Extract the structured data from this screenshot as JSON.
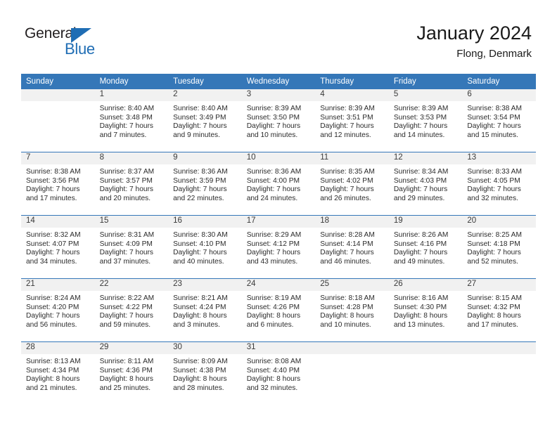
{
  "brand": {
    "name_dark": "General",
    "name_blue": "Blue",
    "accent_color": "#1f6db4"
  },
  "header": {
    "title": "January 2024",
    "subtitle": "Flong, Denmark"
  },
  "calendar": {
    "header_color": "#3577b8",
    "weekday_headers": [
      "Sunday",
      "Monday",
      "Tuesday",
      "Wednesday",
      "Thursday",
      "Friday",
      "Saturday"
    ],
    "weeks": [
      [
        {
          "day": "",
          "sunrise": "",
          "sunset": "",
          "daylight_line1": "",
          "daylight_line2": ""
        },
        {
          "day": "1",
          "sunrise": "Sunrise: 8:40 AM",
          "sunset": "Sunset: 3:48 PM",
          "daylight_line1": "Daylight: 7 hours",
          "daylight_line2": "and 7 minutes."
        },
        {
          "day": "2",
          "sunrise": "Sunrise: 8:40 AM",
          "sunset": "Sunset: 3:49 PM",
          "daylight_line1": "Daylight: 7 hours",
          "daylight_line2": "and 9 minutes."
        },
        {
          "day": "3",
          "sunrise": "Sunrise: 8:39 AM",
          "sunset": "Sunset: 3:50 PM",
          "daylight_line1": "Daylight: 7 hours",
          "daylight_line2": "and 10 minutes."
        },
        {
          "day": "4",
          "sunrise": "Sunrise: 8:39 AM",
          "sunset": "Sunset: 3:51 PM",
          "daylight_line1": "Daylight: 7 hours",
          "daylight_line2": "and 12 minutes."
        },
        {
          "day": "5",
          "sunrise": "Sunrise: 8:39 AM",
          "sunset": "Sunset: 3:53 PM",
          "daylight_line1": "Daylight: 7 hours",
          "daylight_line2": "and 14 minutes."
        },
        {
          "day": "6",
          "sunrise": "Sunrise: 8:38 AM",
          "sunset": "Sunset: 3:54 PM",
          "daylight_line1": "Daylight: 7 hours",
          "daylight_line2": "and 15 minutes."
        }
      ],
      [
        {
          "day": "7",
          "sunrise": "Sunrise: 8:38 AM",
          "sunset": "Sunset: 3:56 PM",
          "daylight_line1": "Daylight: 7 hours",
          "daylight_line2": "and 17 minutes."
        },
        {
          "day": "8",
          "sunrise": "Sunrise: 8:37 AM",
          "sunset": "Sunset: 3:57 PM",
          "daylight_line1": "Daylight: 7 hours",
          "daylight_line2": "and 20 minutes."
        },
        {
          "day": "9",
          "sunrise": "Sunrise: 8:36 AM",
          "sunset": "Sunset: 3:59 PM",
          "daylight_line1": "Daylight: 7 hours",
          "daylight_line2": "and 22 minutes."
        },
        {
          "day": "10",
          "sunrise": "Sunrise: 8:36 AM",
          "sunset": "Sunset: 4:00 PM",
          "daylight_line1": "Daylight: 7 hours",
          "daylight_line2": "and 24 minutes."
        },
        {
          "day": "11",
          "sunrise": "Sunrise: 8:35 AM",
          "sunset": "Sunset: 4:02 PM",
          "daylight_line1": "Daylight: 7 hours",
          "daylight_line2": "and 26 minutes."
        },
        {
          "day": "12",
          "sunrise": "Sunrise: 8:34 AM",
          "sunset": "Sunset: 4:03 PM",
          "daylight_line1": "Daylight: 7 hours",
          "daylight_line2": "and 29 minutes."
        },
        {
          "day": "13",
          "sunrise": "Sunrise: 8:33 AM",
          "sunset": "Sunset: 4:05 PM",
          "daylight_line1": "Daylight: 7 hours",
          "daylight_line2": "and 32 minutes."
        }
      ],
      [
        {
          "day": "14",
          "sunrise": "Sunrise: 8:32 AM",
          "sunset": "Sunset: 4:07 PM",
          "daylight_line1": "Daylight: 7 hours",
          "daylight_line2": "and 34 minutes."
        },
        {
          "day": "15",
          "sunrise": "Sunrise: 8:31 AM",
          "sunset": "Sunset: 4:09 PM",
          "daylight_line1": "Daylight: 7 hours",
          "daylight_line2": "and 37 minutes."
        },
        {
          "day": "16",
          "sunrise": "Sunrise: 8:30 AM",
          "sunset": "Sunset: 4:10 PM",
          "daylight_line1": "Daylight: 7 hours",
          "daylight_line2": "and 40 minutes."
        },
        {
          "day": "17",
          "sunrise": "Sunrise: 8:29 AM",
          "sunset": "Sunset: 4:12 PM",
          "daylight_line1": "Daylight: 7 hours",
          "daylight_line2": "and 43 minutes."
        },
        {
          "day": "18",
          "sunrise": "Sunrise: 8:28 AM",
          "sunset": "Sunset: 4:14 PM",
          "daylight_line1": "Daylight: 7 hours",
          "daylight_line2": "and 46 minutes."
        },
        {
          "day": "19",
          "sunrise": "Sunrise: 8:26 AM",
          "sunset": "Sunset: 4:16 PM",
          "daylight_line1": "Daylight: 7 hours",
          "daylight_line2": "and 49 minutes."
        },
        {
          "day": "20",
          "sunrise": "Sunrise: 8:25 AM",
          "sunset": "Sunset: 4:18 PM",
          "daylight_line1": "Daylight: 7 hours",
          "daylight_line2": "and 52 minutes."
        }
      ],
      [
        {
          "day": "21",
          "sunrise": "Sunrise: 8:24 AM",
          "sunset": "Sunset: 4:20 PM",
          "daylight_line1": "Daylight: 7 hours",
          "daylight_line2": "and 56 minutes."
        },
        {
          "day": "22",
          "sunrise": "Sunrise: 8:22 AM",
          "sunset": "Sunset: 4:22 PM",
          "daylight_line1": "Daylight: 7 hours",
          "daylight_line2": "and 59 minutes."
        },
        {
          "day": "23",
          "sunrise": "Sunrise: 8:21 AM",
          "sunset": "Sunset: 4:24 PM",
          "daylight_line1": "Daylight: 8 hours",
          "daylight_line2": "and 3 minutes."
        },
        {
          "day": "24",
          "sunrise": "Sunrise: 8:19 AM",
          "sunset": "Sunset: 4:26 PM",
          "daylight_line1": "Daylight: 8 hours",
          "daylight_line2": "and 6 minutes."
        },
        {
          "day": "25",
          "sunrise": "Sunrise: 8:18 AM",
          "sunset": "Sunset: 4:28 PM",
          "daylight_line1": "Daylight: 8 hours",
          "daylight_line2": "and 10 minutes."
        },
        {
          "day": "26",
          "sunrise": "Sunrise: 8:16 AM",
          "sunset": "Sunset: 4:30 PM",
          "daylight_line1": "Daylight: 8 hours",
          "daylight_line2": "and 13 minutes."
        },
        {
          "day": "27",
          "sunrise": "Sunrise: 8:15 AM",
          "sunset": "Sunset: 4:32 PM",
          "daylight_line1": "Daylight: 8 hours",
          "daylight_line2": "and 17 minutes."
        }
      ],
      [
        {
          "day": "28",
          "sunrise": "Sunrise: 8:13 AM",
          "sunset": "Sunset: 4:34 PM",
          "daylight_line1": "Daylight: 8 hours",
          "daylight_line2": "and 21 minutes."
        },
        {
          "day": "29",
          "sunrise": "Sunrise: 8:11 AM",
          "sunset": "Sunset: 4:36 PM",
          "daylight_line1": "Daylight: 8 hours",
          "daylight_line2": "and 25 minutes."
        },
        {
          "day": "30",
          "sunrise": "Sunrise: 8:09 AM",
          "sunset": "Sunset: 4:38 PM",
          "daylight_line1": "Daylight: 8 hours",
          "daylight_line2": "and 28 minutes."
        },
        {
          "day": "31",
          "sunrise": "Sunrise: 8:08 AM",
          "sunset": "Sunset: 4:40 PM",
          "daylight_line1": "Daylight: 8 hours",
          "daylight_line2": "and 32 minutes."
        },
        {
          "day": "",
          "sunrise": "",
          "sunset": "",
          "daylight_line1": "",
          "daylight_line2": ""
        },
        {
          "day": "",
          "sunrise": "",
          "sunset": "",
          "daylight_line1": "",
          "daylight_line2": ""
        },
        {
          "day": "",
          "sunrise": "",
          "sunset": "",
          "daylight_line1": "",
          "daylight_line2": ""
        }
      ]
    ]
  }
}
